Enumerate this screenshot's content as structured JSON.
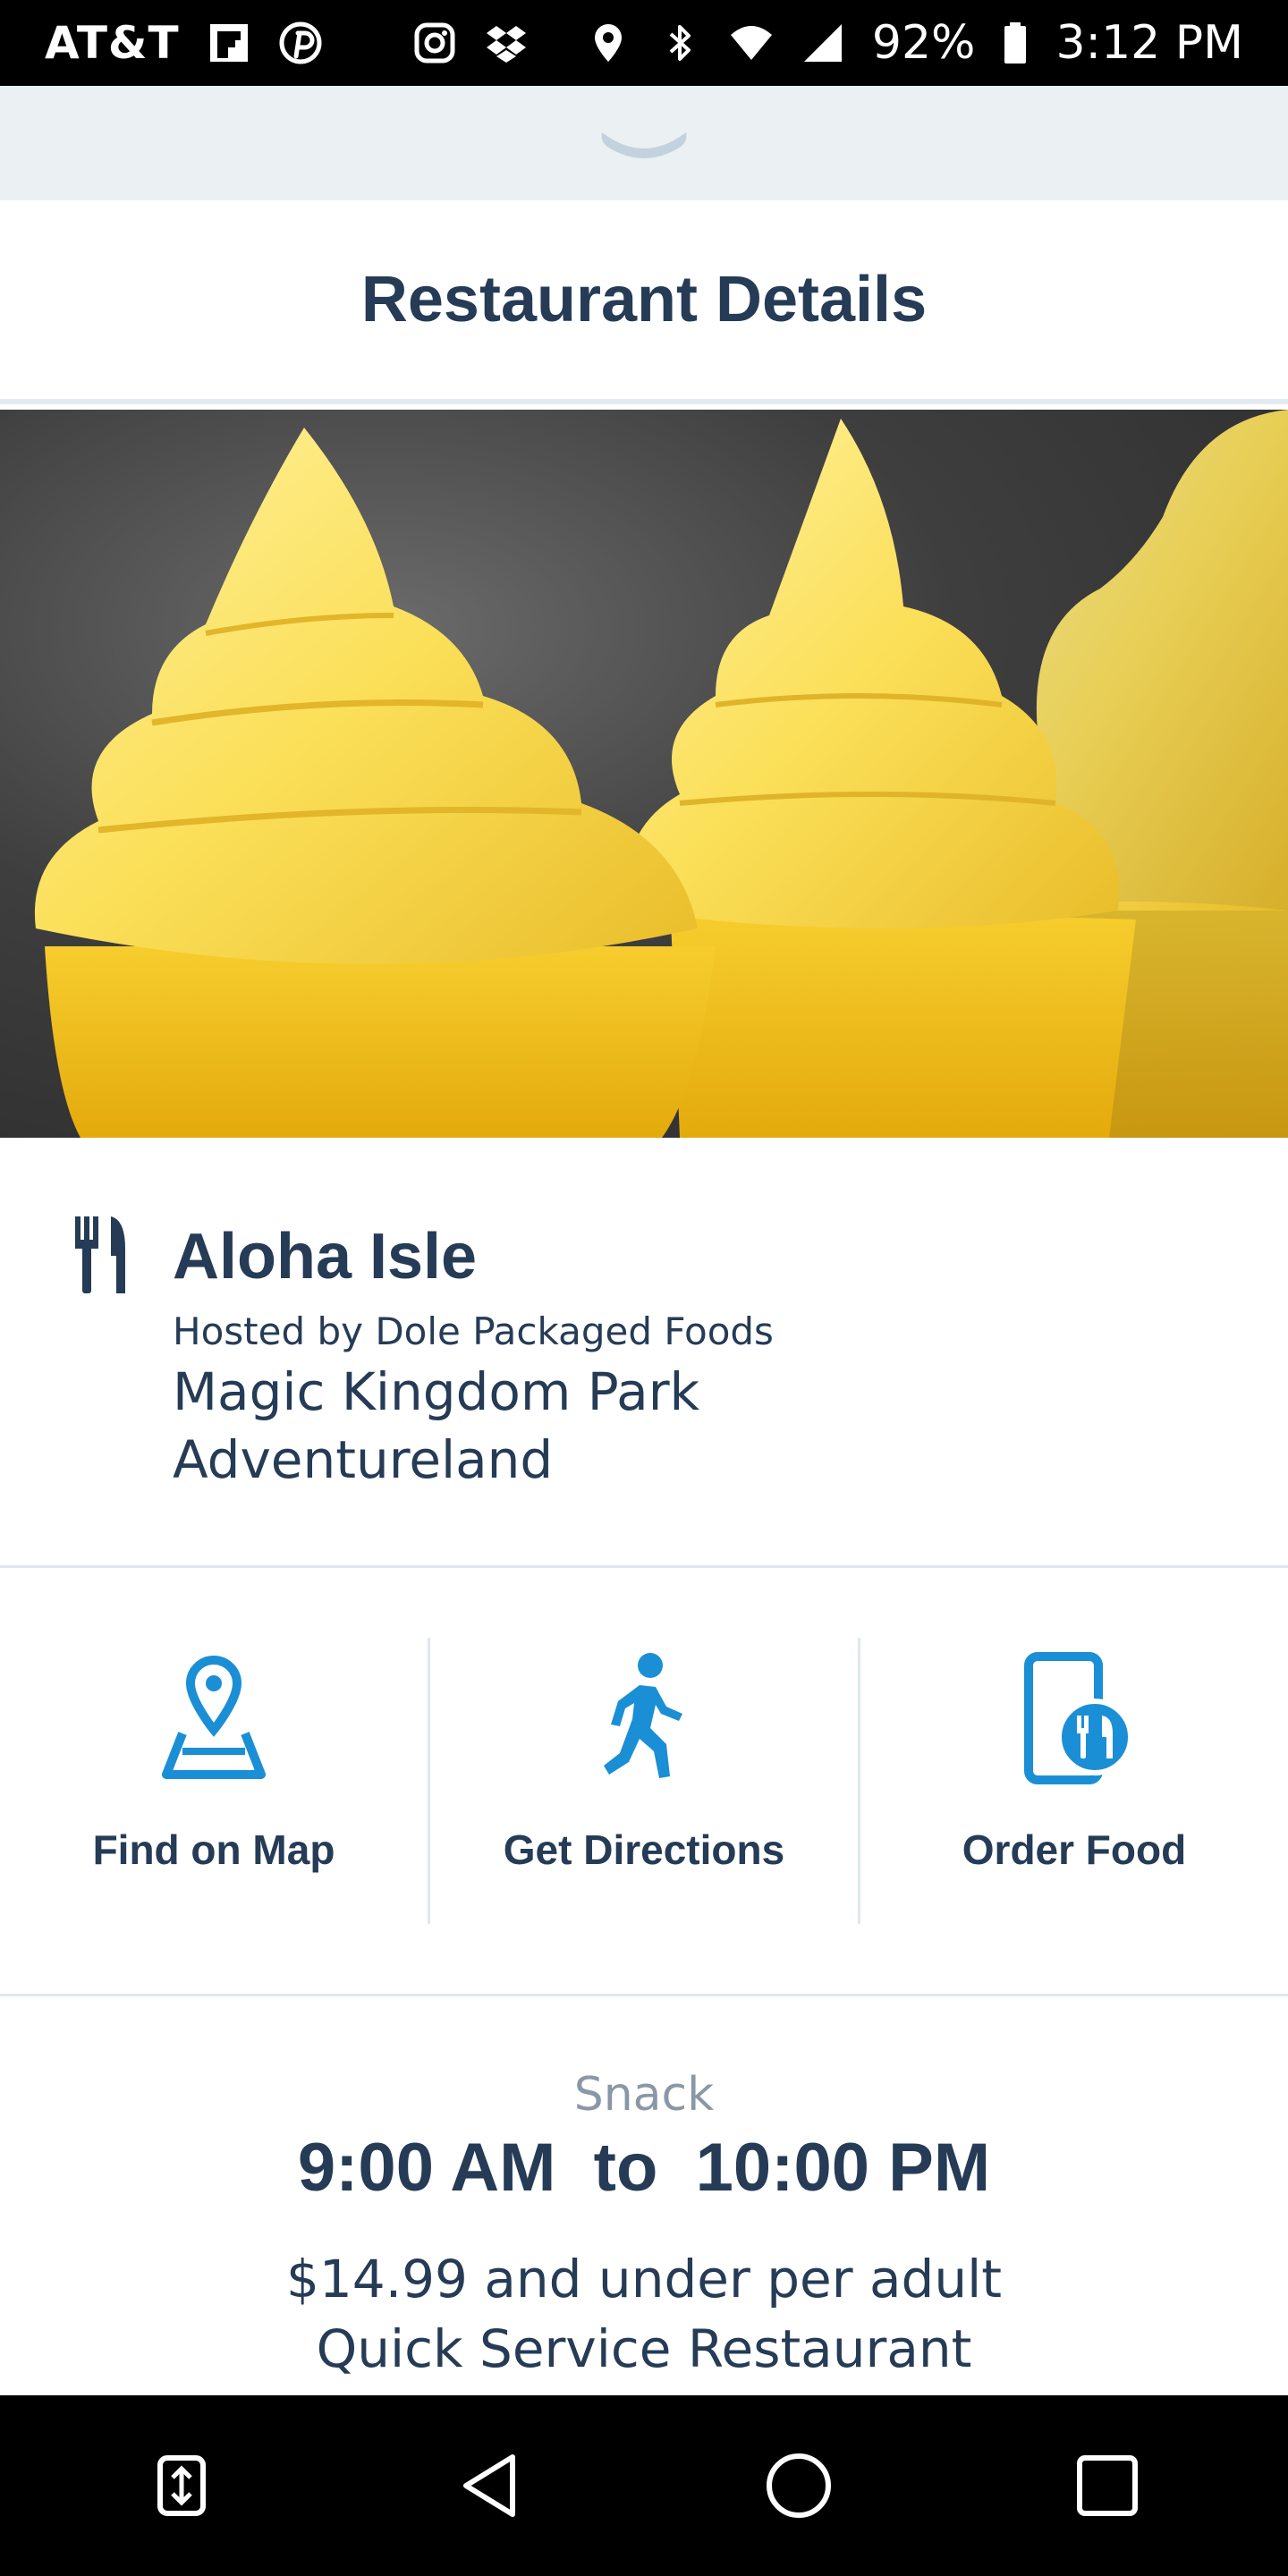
{
  "status_bar": {
    "carrier": "AT&T",
    "battery": "92%",
    "time": "3:12 PM",
    "icons": [
      "flipboard-icon",
      "pinterest-icon",
      "instagram-icon",
      "dropbox-icon",
      "location-icon",
      "bluetooth-icon",
      "wifi-icon",
      "signal-icon",
      "battery-icon"
    ]
  },
  "header": {
    "title": "Restaurant Details"
  },
  "hero": {
    "image": "dole-whip-photo"
  },
  "restaurant": {
    "name": "Aloha Isle",
    "hosted_by": "Hosted by Dole Packaged Foods",
    "park": "Magic Kingdom Park",
    "land": "Adventureland"
  },
  "actions": [
    {
      "label": "Find on Map",
      "icon": "map-pin-icon"
    },
    {
      "label": "Get Directions",
      "icon": "walking-person-icon"
    },
    {
      "label": "Order Food",
      "icon": "mobile-order-icon"
    }
  ],
  "details": {
    "category": "Snack",
    "hours": "9:00 AM  to  10:00 PM",
    "price": "$14.99 and under per adult",
    "service_type": "Quick Service Restaurant"
  },
  "colors": {
    "accent_blue": "#1a8fd6",
    "text_navy": "#253b56",
    "muted_gray": "#8a97a6"
  }
}
